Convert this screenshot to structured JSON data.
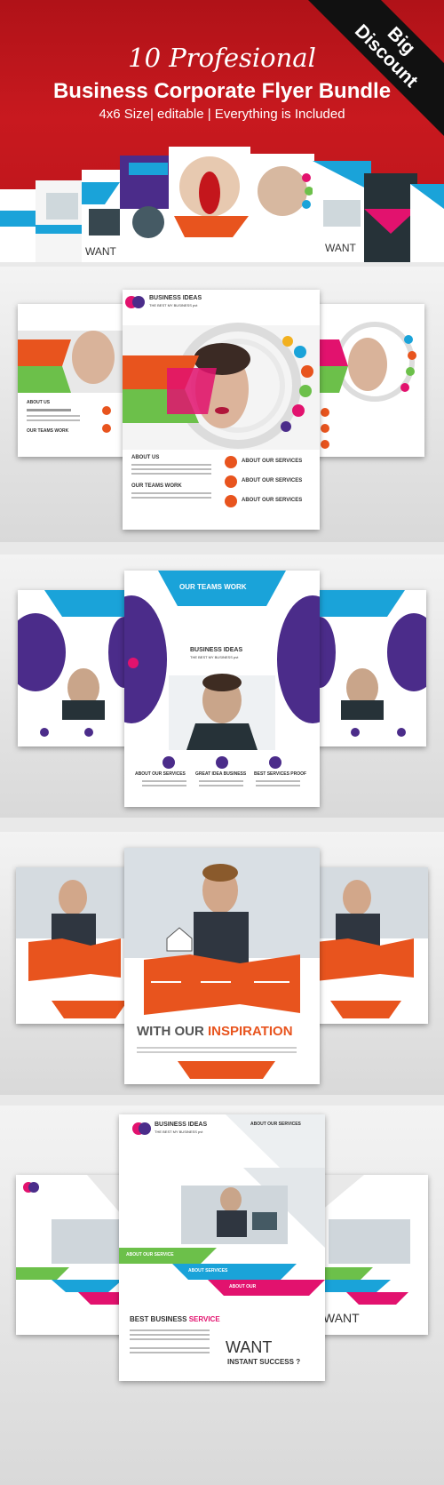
{
  "header": {
    "ribbon_line1": "Big",
    "ribbon_line2": "Discount",
    "title_script": "10 Profesional",
    "title_main": "Business Corporate Flyer Bundle",
    "subtitle": "4x6 Size| editable | Everything is  Included"
  },
  "colors": {
    "header_red": "#c4161c",
    "orange": "#e8541e",
    "blue": "#1aa3d9",
    "purple": "#4b2c8a",
    "green": "#6cc04a",
    "pink": "#e2126e"
  },
  "flyer1": {
    "brand": "BUSINESS IDEAS",
    "tagline": "THE BEST MY BUSINESS pvt",
    "about_us": "ABOUT US",
    "team_work": "OUR TEAMS WORK",
    "services": [
      "ABOUT OUR SERVICES",
      "ABOUT OUR SERVICES",
      "ABOUT OUR SERVICES"
    ]
  },
  "flyer2": {
    "heading": "OUR TEAMS WORK",
    "brand": "BUSINESS IDEAS",
    "tagline": "THE BEST MY BUSINESS pvt",
    "columns": [
      "ABOUT OUR SERVICES",
      "GREAT IDEA BUSINESS",
      "BEST SERVICES PROOF"
    ]
  },
  "flyer3": {
    "headline_a": "WITH OUR ",
    "headline_b": "INSPIRATION"
  },
  "flyer4": {
    "brand": "BUSINESS IDEAS",
    "tagline": "THE BEST MY BUSINESS pvt",
    "about_services": "ABOUT OUR SERVICES",
    "band_labels": [
      "ABOUT OUR SERVICE",
      "ABOUT SERVICES",
      "ABOUT OUR"
    ],
    "best_a": "BEST BUSINESS ",
    "best_b": "SERVICE",
    "want": "WANT",
    "instant": "INSTANT SUCCESS ?"
  }
}
